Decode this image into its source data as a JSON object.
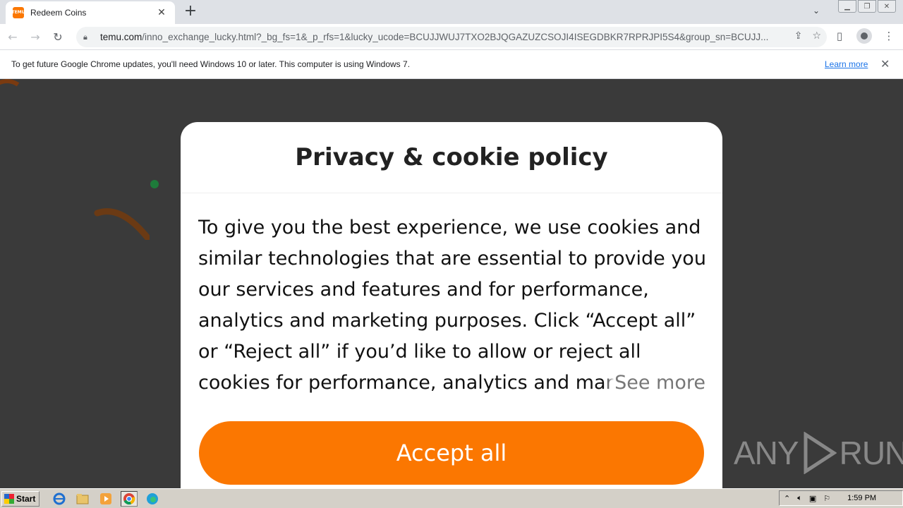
{
  "browser": {
    "tab": {
      "favicon_text": "TEMU",
      "title": "Redeem Coins"
    },
    "url": {
      "host": "temu.com",
      "path": "/inno_exchange_lucky.html?_bg_fs=1&_p_rfs=1&lucky_ucode=BCUJJWUJ7TXO2BJQGAZUZCSOJI4ISEGDBKR7RPRJPI5S4&group_sn=BCUJJ..."
    },
    "infobar": {
      "message": "To get future Google Chrome updates, you'll need Windows 10 or later. This computer is using Windows 7.",
      "link": "Learn more"
    }
  },
  "modal": {
    "title": "Privacy & cookie policy",
    "body": "To give you the best experience, we use cookies and similar technologies that are essential to provide you our services and features and for performance, analytics and marketing purposes. Click “Accept all” or “Reject all” if you’d like to allow or reject all cookies for performance, analytics and marketing purposes.",
    "see_more": "See more",
    "accept_button": "Accept all"
  },
  "watermark": {
    "left": "ANY",
    "right": "RUN"
  },
  "taskbar": {
    "start_label": "Start",
    "clock": "1:59 PM"
  },
  "colors": {
    "accent": "#fb7701",
    "link": "#1a73e8"
  }
}
